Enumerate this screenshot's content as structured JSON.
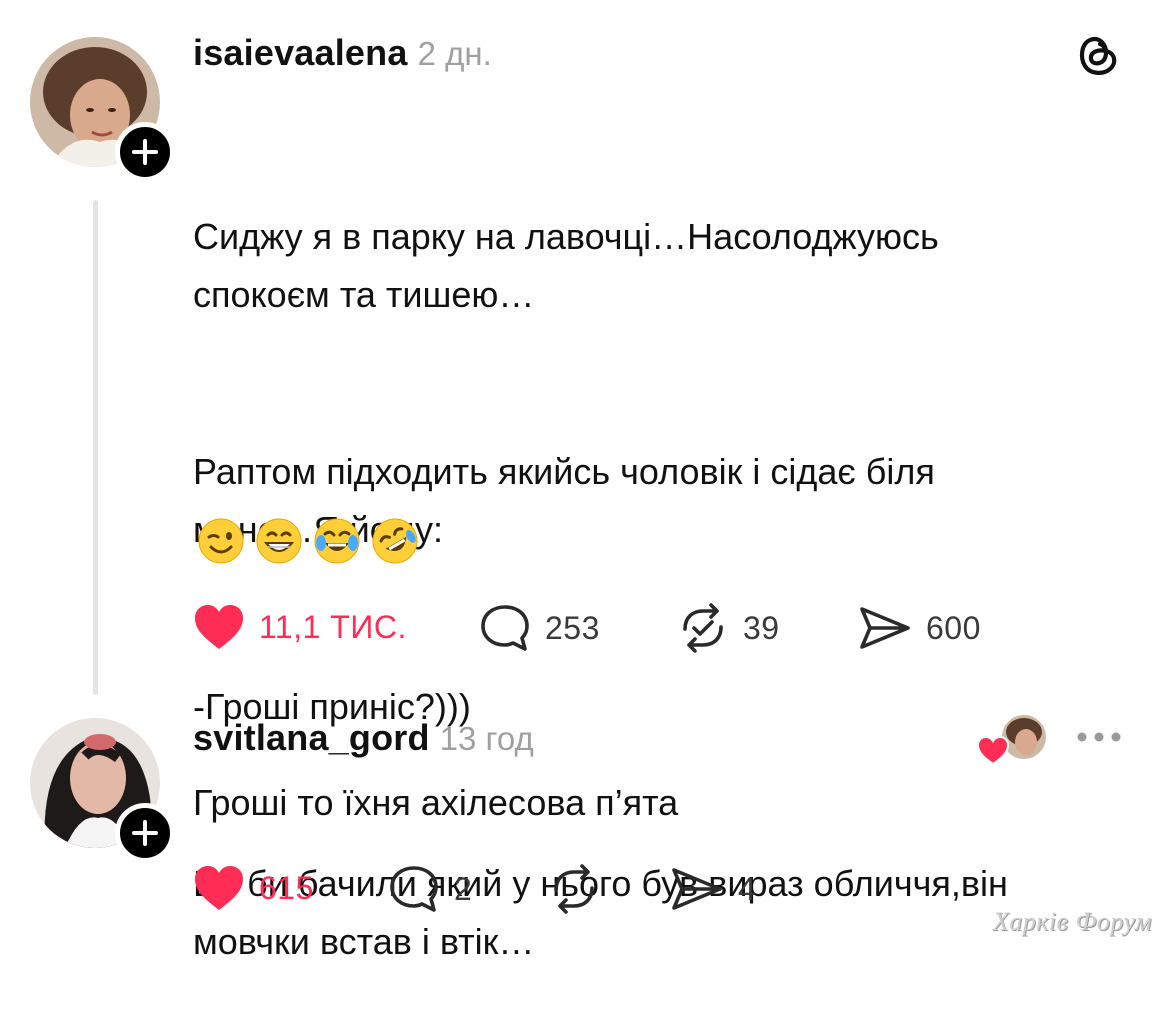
{
  "post": {
    "username": "isaievaalena",
    "time": "2 дн.",
    "avatar_icon": "user-photo",
    "follow_icon": "plus-icon",
    "app_icon": "threads-logo-icon",
    "paragraphs": [
      "Сиджу я в парку на лавочці…Насолоджуюсь\nспокоєм та тишею…",
      "Раптом підходить якийсь чоловік і сідає біля\nмене…Я йому:",
      "-Гроші приніс?)))",
      "Ви би бачили який у нього був вираз обличчя,він\nмовчки встав і втік…"
    ],
    "emojis": [
      "winking-face",
      "grinning-face",
      "tears-of-joy-face",
      "rolling-on-floor-laughing-face"
    ],
    "likes": "11,1 ТИС.",
    "comments": "253",
    "reposts": "39",
    "shares": "600",
    "liked": true
  },
  "reply": {
    "username": "svitlana_gord",
    "time": "13 год",
    "text": "Гроші то їхня ахілесова п’ята",
    "likes": "615",
    "comments": "2",
    "reposts": "",
    "shares": "4",
    "liked": true,
    "liked_by_author_icon": "heart-avatar-icon",
    "more_icon": "more-dots-icon"
  },
  "watermark": "Харків Форум",
  "colors": {
    "like": "#ff2d55",
    "text": "#111111",
    "muted": "#a0a0a0",
    "thread_line": "#e4e4e4"
  }
}
